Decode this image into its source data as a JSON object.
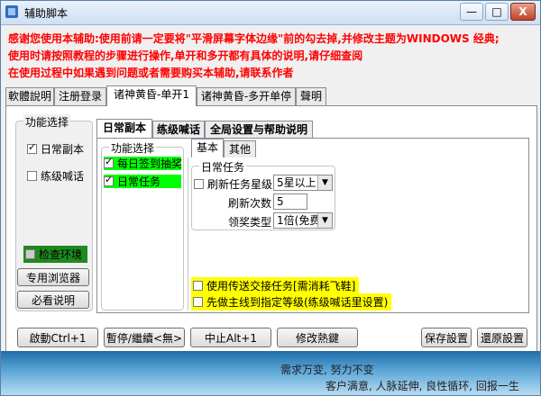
{
  "window": {
    "title": "辅助脚本",
    "buttons": {
      "minimize": "—",
      "maximize": "□",
      "close": "X"
    }
  },
  "notices": [
    "感谢您使用本辅助:使用前请一定要将\"平滑屏幕字体边缘\"前的勾去掉,并修改主题为WINDOWS 经典;",
    "使用时请按照教程的步骤进行操作,单开和多开都有具体的说明,请仔细查阅",
    "在使用过程中如果遇到问题或者需要购买本辅助,请联系作者"
  ],
  "top_tabs": [
    "軟體說明",
    "注册登录",
    "诸神黄昏-单开1",
    "诸神黄昏-多开单停",
    "聲明"
  ],
  "left_panel": {
    "legend": "功能选择",
    "options": [
      {
        "label": "日常副本",
        "checked": true
      },
      {
        "label": "练级喊话",
        "checked": false
      }
    ],
    "check_env": "检查环境",
    "browser_button": "专用浏览器",
    "read_button": "必看说明"
  },
  "mid_tabs": [
    "日常副本",
    "练级喊话",
    "全局设置与帮助说明"
  ],
  "func_group": {
    "legend": "功能选择",
    "items": [
      {
        "label": "每日签到抽奖",
        "checked": true
      },
      {
        "label": "日常任务",
        "checked": true
      }
    ]
  },
  "sub_tabs": [
    "基本",
    "其他"
  ],
  "daily_task": {
    "legend": "日常任务",
    "refresh_star_label": "刷新任务星级",
    "refresh_star_checked": false,
    "refresh_star_value": "5星以上",
    "refresh_count_label": "刷新次数",
    "refresh_count_value": "5",
    "reward_type_label": "领奖类型",
    "reward_type_value": "1倍(免费)"
  },
  "bottom_options": [
    {
      "label": "使用传送交接任务[需消耗飞鞋]",
      "checked": false
    },
    {
      "label": "先做主线到指定等级(练级喊话里设置)",
      "checked": false
    }
  ],
  "buttons": {
    "start": "啟動Ctrl+1",
    "pause": "暫停/繼續<無>",
    "stop": "中止Alt+1",
    "hotkey": "修改熱鍵",
    "save": "保存設置",
    "restore": "還原設置"
  },
  "footer": {
    "line1": "需求万变, 努力不变",
    "line2": "客户满意, 人脉延伸, 良性循环, 回报一生"
  },
  "colors": {
    "notice": "#ff0000",
    "highlight_green": "#00ff00",
    "highlight_yellow": "#ffff00"
  }
}
